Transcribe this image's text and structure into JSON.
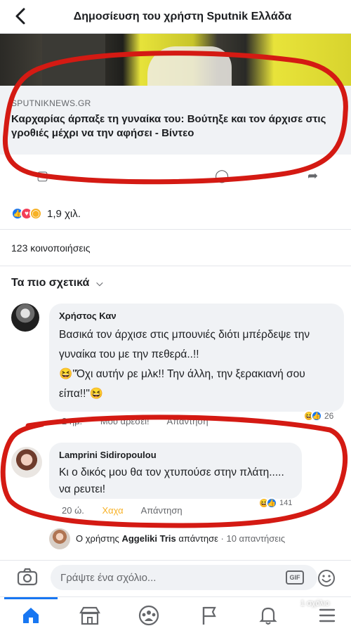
{
  "header": {
    "title": "Δημοσίευση του χρήστη Sputnik Ελλάδα"
  },
  "link": {
    "domain": "SPUTNIKNEWS.GR",
    "title": "Καρχαρίας άρπαξε τη γυναίκα του: Βούτηξε και τον άρχισε στις γροθιές μέχρι να την αφήσει - Βίντεο"
  },
  "post": {
    "reactions_count": "1,9 χιλ.",
    "shares": "123 κοινοποιήσεις"
  },
  "comments_sort": "Τα πιο σχετικά",
  "comments": [
    {
      "author": "Χρήστος Καν",
      "text_1": "Βασικά τον άρχισε στις μπουνιές διότι μπέρδεψε την γυναίκα του με την πεθερά..!!",
      "text_2": "\"Όχι αυτήν ρε μλκ!! Την άλλη, την ξερακιανή σου είπα!!\"",
      "time": "2 ημ.",
      "like": "Μου αρέσει!",
      "reply": "Απάντηση",
      "reactions_count": "26"
    },
    {
      "author": "Lamprini Sidiropoulou",
      "text": "Κι ο δικός μου θα τον χτυπούσε στην πλάτη.....     να ρευτει!",
      "time": "20 ώ.",
      "like": "Χαχα",
      "reply": "Απάντηση",
      "reactions_count": "141"
    }
  ],
  "reply_summary": {
    "prefix": "Ο χρήστης",
    "name": "Aggeliki Tris",
    "action": "απάντησε",
    "count": "· 10 απαντήσεις"
  },
  "composer": {
    "placeholder": "Γράψτε ένα σχόλιο..."
  },
  "watermark": "1 σχόλιο",
  "colors": {
    "brand_blue": "#1877f2",
    "annotation_red": "#d41a13",
    "haha_yellow": "#f7b125"
  },
  "icons": [
    "back-icon",
    "camera-icon",
    "gif-icon",
    "emoji-icon",
    "home-icon",
    "marketplace-icon",
    "groups-icon",
    "pages-flag-icon",
    "notifications-bell-icon",
    "menu-icon"
  ]
}
